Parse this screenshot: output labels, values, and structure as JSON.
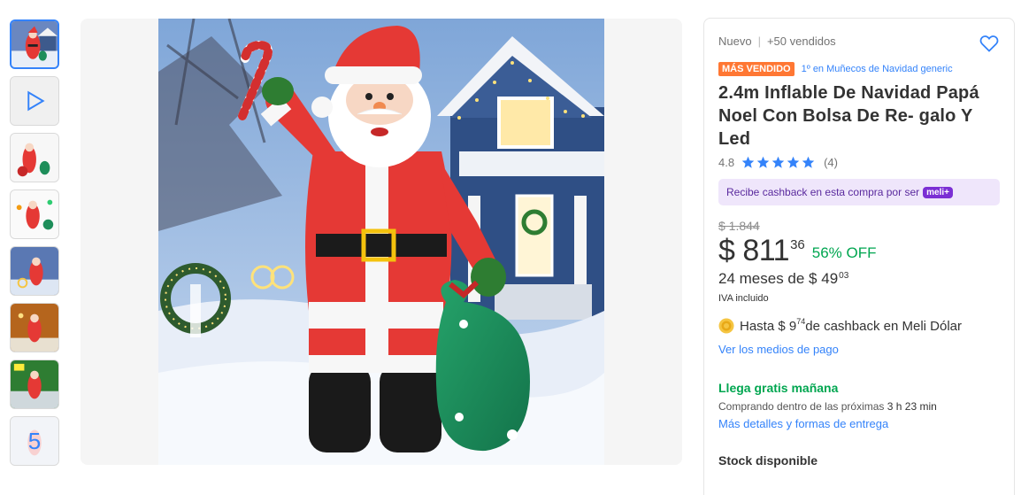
{
  "gallery": {
    "more_count": "5",
    "thumbnails": [
      "santa-thumb-1",
      "video-thumb",
      "santa-thumb-3",
      "santa-thumb-4",
      "santa-thumb-5",
      "santa-thumb-6",
      "santa-thumb-7",
      "more-thumb"
    ]
  },
  "product": {
    "condition": "Nuevo",
    "sold": "+50 vendidos",
    "badge": "MÁS VENDIDO",
    "rank": "1º en Muñecos de Navidad generic",
    "title": "2.4m Inflable De Navidad Papá Noel Con Bolsa De Re- galo Y Led",
    "rating_value": "4.8",
    "rating_count": "(4)",
    "stars": 5,
    "cashback_text": "Recibe cashback en esta compra por ser",
    "cashback_badge": "meli+",
    "old_price": "$ 1.844",
    "price_integer": "$ 811",
    "price_cents": "36",
    "discount": "56% OFF",
    "installments_text": "24 meses de $ 49",
    "installments_cents": "03",
    "iva": "IVA incluido",
    "meli_dolar_prefix": "Hasta $ 9",
    "meli_dolar_cents": "74",
    "meli_dolar_suffix": " de cashback en Meli Dólar",
    "payment_link": "Ver los medios de pago"
  },
  "shipping": {
    "title": "Llega gratis mañana",
    "time_prefix": "Comprando dentro de las próximas ",
    "time_value": "3 h 23 min",
    "details_link": "Más detalles y formas de entrega"
  },
  "stock": {
    "label": "Stock disponible"
  },
  "colors": {
    "accent": "#3483fa",
    "green": "#00a650",
    "badge_orange": "#ff7733",
    "purple": "#7b2fd4"
  }
}
